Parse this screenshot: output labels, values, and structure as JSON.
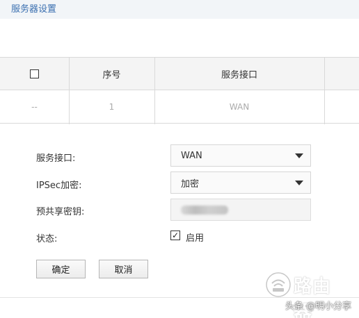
{
  "header": {
    "title": "服务器设置"
  },
  "table": {
    "columns": [
      "序号",
      "服务接口"
    ],
    "rows": [
      {
        "select": "--",
        "index": "1",
        "interface": "WAN"
      }
    ]
  },
  "form": {
    "interface_label": "服务接口:",
    "interface_value": "WAN",
    "ipsec_label": "IPSec加密:",
    "ipsec_value": "加密",
    "psk_label": "预共享密钥:",
    "status_label": "状态:",
    "status_option": "启用",
    "status_checked": true
  },
  "buttons": {
    "ok": "确定",
    "cancel": "取消"
  },
  "watermark": {
    "logo_text": "路由器",
    "credit": "头条 @明小分享"
  }
}
